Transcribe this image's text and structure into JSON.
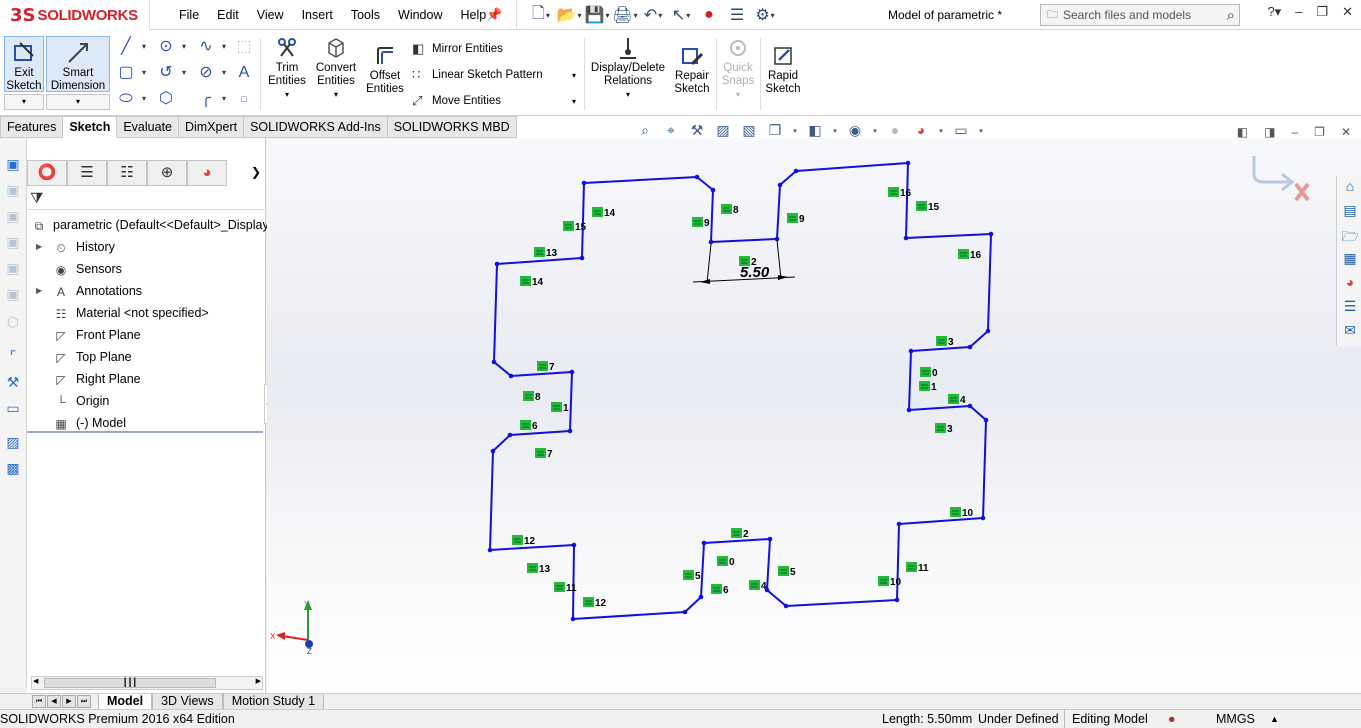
{
  "app": {
    "logo_mark": "3S",
    "logo_text": "SOLIDWORKS",
    "document_title": "Model of parametric *"
  },
  "menu": [
    "File",
    "Edit",
    "View",
    "Insert",
    "Tools",
    "Window",
    "Help"
  ],
  "search": {
    "placeholder": "Search files and models"
  },
  "ribbon": {
    "exit_sketch": [
      "Exit",
      "Sketch"
    ],
    "smart_dimension": [
      "Smart",
      "Dimension"
    ],
    "trim_entities": [
      "Trim",
      "Entities"
    ],
    "convert_entities": [
      "Convert",
      "Entities"
    ],
    "offset_entities": [
      "Offset",
      "Entities"
    ],
    "mirror_entities": "Mirror Entities",
    "linear_sketch_pattern": "Linear Sketch Pattern",
    "move_entities": "Move Entities",
    "display_delete_relations": [
      "Display/Delete",
      "Relations"
    ],
    "repair_sketch": [
      "Repair",
      "Sketch"
    ],
    "quick_snaps": [
      "Quick",
      "Snaps"
    ],
    "rapid_sketch": [
      "Rapid",
      "Sketch"
    ]
  },
  "tabs": [
    {
      "label": "Features",
      "active": false
    },
    {
      "label": "Sketch",
      "active": true
    },
    {
      "label": "Evaluate",
      "active": false
    },
    {
      "label": "DimXpert",
      "active": false
    },
    {
      "label": "SOLIDWORKS Add-Ins",
      "active": false
    },
    {
      "label": "SOLIDWORKS MBD",
      "active": false
    }
  ],
  "feature_tree": {
    "root": "parametric  (Default<<Default>_Display",
    "items": [
      {
        "label": "History",
        "expandable": true,
        "icon": "history-icon"
      },
      {
        "label": "Sensors",
        "expandable": false,
        "icon": "sensor-icon"
      },
      {
        "label": "Annotations",
        "expandable": true,
        "icon": "annotation-icon"
      },
      {
        "label": "Material <not specified>",
        "expandable": false,
        "icon": "material-icon"
      },
      {
        "label": "Front Plane",
        "expandable": false,
        "icon": "plane-icon"
      },
      {
        "label": "Top Plane",
        "expandable": false,
        "icon": "plane-icon"
      },
      {
        "label": "Right Plane",
        "expandable": false,
        "icon": "plane-icon"
      },
      {
        "label": "Origin",
        "expandable": false,
        "icon": "origin-icon"
      },
      {
        "label": "(-) Model",
        "expandable": false,
        "icon": "sketch-icon"
      }
    ]
  },
  "sketch": {
    "dimension_text": "5.50",
    "line_color": "#1010e0",
    "relation_color": "#22bb33",
    "triad": {
      "x": "X",
      "y": "Y",
      "z": "Z"
    },
    "relation_labels": [
      "1",
      "0",
      "2",
      "3",
      "4",
      "5",
      "6",
      "7",
      "8",
      "9",
      "10",
      "11",
      "12",
      "13",
      "14",
      "15",
      "16"
    ]
  },
  "bottom_tabs": [
    {
      "label": "Model",
      "active": true
    },
    {
      "label": "3D Views",
      "active": false
    },
    {
      "label": "Motion Study 1",
      "active": false
    }
  ],
  "status": {
    "edition": "SOLIDWORKS Premium 2016 x64 Edition",
    "length": "Length: 5.50mm",
    "definition": "Under Defined",
    "mode": "Editing Model",
    "units": "MMGS"
  }
}
